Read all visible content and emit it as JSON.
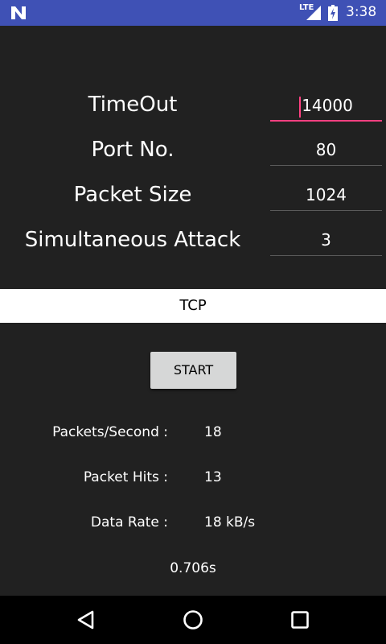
{
  "status_bar": {
    "network_label": "LTE",
    "time": "3:38",
    "icons": [
      "notification-n-icon",
      "signal-icon",
      "battery-charging-icon"
    ]
  },
  "form": {
    "timeout": {
      "label": "TimeOut",
      "value": "14000"
    },
    "port": {
      "label": "Port No.",
      "value": "80"
    },
    "packet_size": {
      "label": "Packet Size",
      "value": "1024"
    },
    "simultaneous": {
      "label": "Simultaneous Attack",
      "value": "3"
    }
  },
  "protocol": {
    "selected": "TCP"
  },
  "start_button": {
    "label": "START"
  },
  "stats": {
    "packets_per_second": {
      "label": "Packets/Second :",
      "value": "18"
    },
    "packet_hits": {
      "label": "Packet Hits :",
      "value": "13"
    },
    "data_rate": {
      "label": "Data Rate :",
      "value": "18 kB/s"
    },
    "elapsed": "0.706s"
  },
  "nav_bar": {
    "icons": [
      "back-icon",
      "home-icon",
      "recents-icon"
    ]
  },
  "colors": {
    "status_bar": "#3f51b5",
    "background": "#212121",
    "accent": "#ff4081",
    "button": "#d6d7d7"
  }
}
